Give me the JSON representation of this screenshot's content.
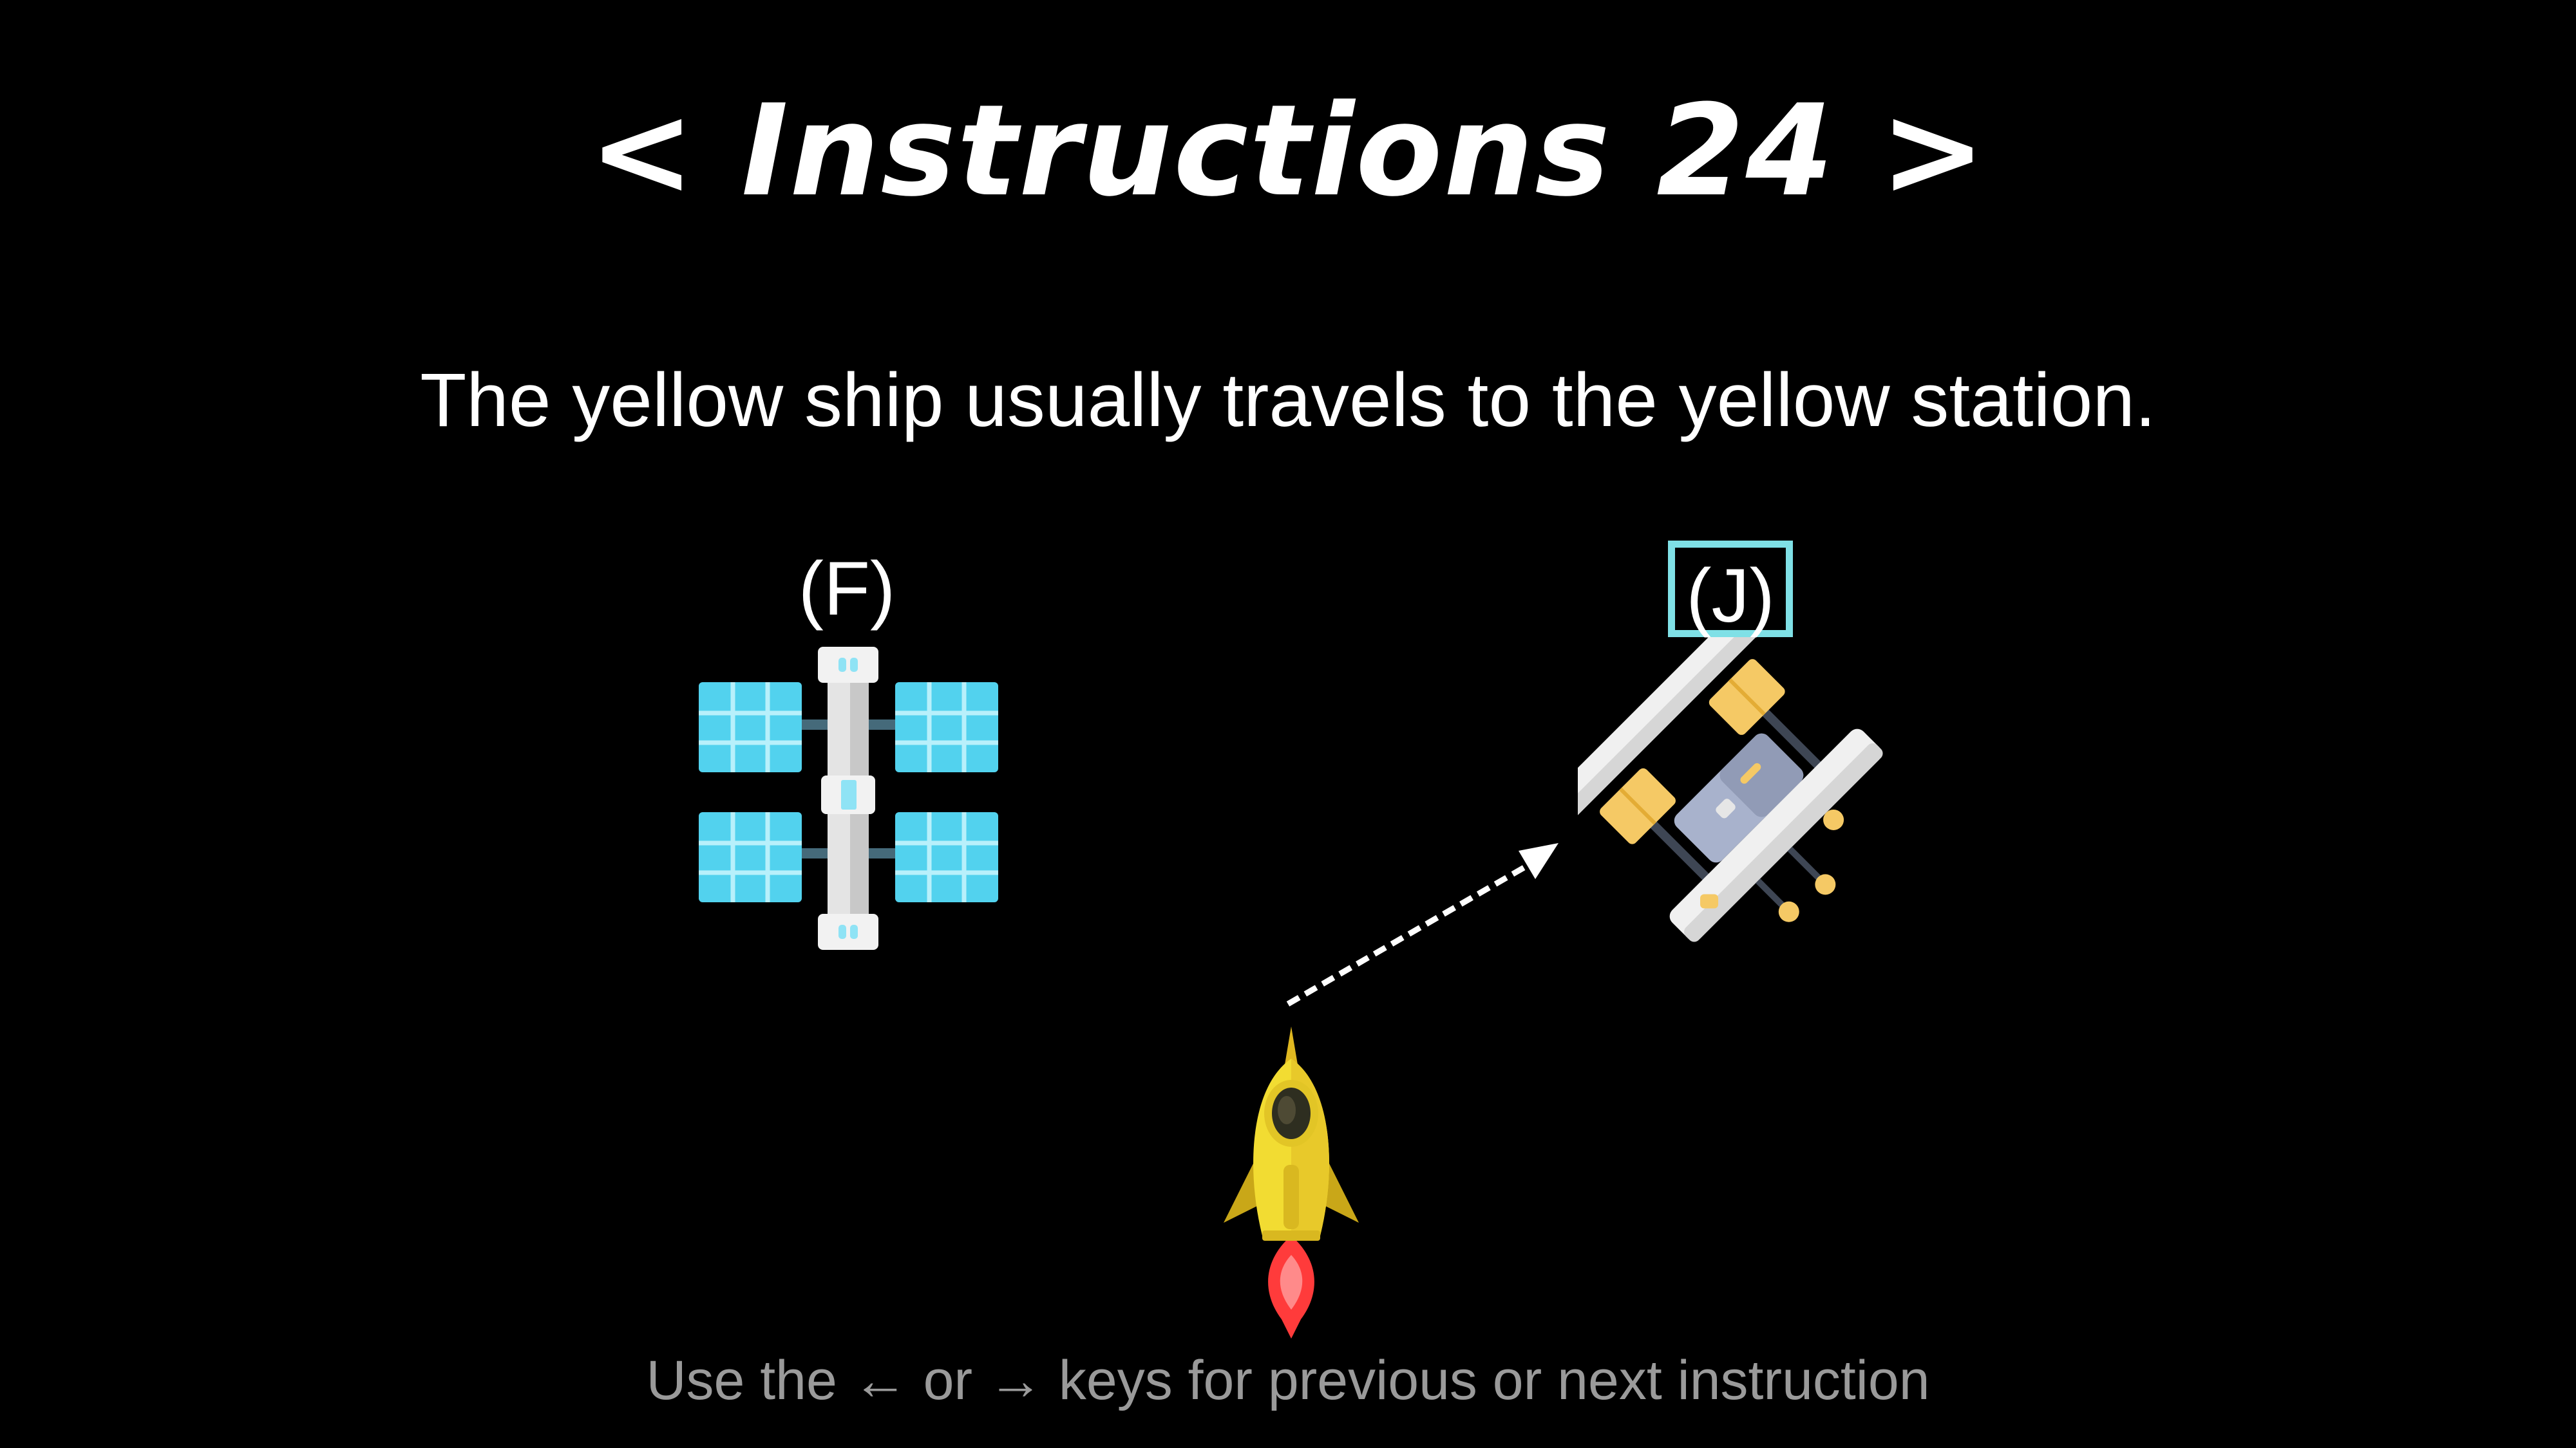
{
  "header": {
    "title": "< Instructions 24 >"
  },
  "instruction": {
    "text": "The yellow ship usually travels to the yellow station."
  },
  "options": {
    "left_key": "(F)",
    "right_key": "(J)",
    "selected": "J"
  },
  "icons": {
    "left_station": "space-station-icon",
    "right_station": "space-station-icon",
    "ship": "rocket-icon",
    "path": "dashed-arrow"
  },
  "footer": {
    "hint": "Use the ← or → keys for previous or next instruction"
  },
  "colors": {
    "background": "#000000",
    "text": "#ffffff",
    "hint": "#9a9a9a",
    "highlight": "#7fe0e6",
    "ship_yellow": "#f2dc32",
    "station_yellow": "#f5c965",
    "station_blue": "#52d2ee"
  }
}
